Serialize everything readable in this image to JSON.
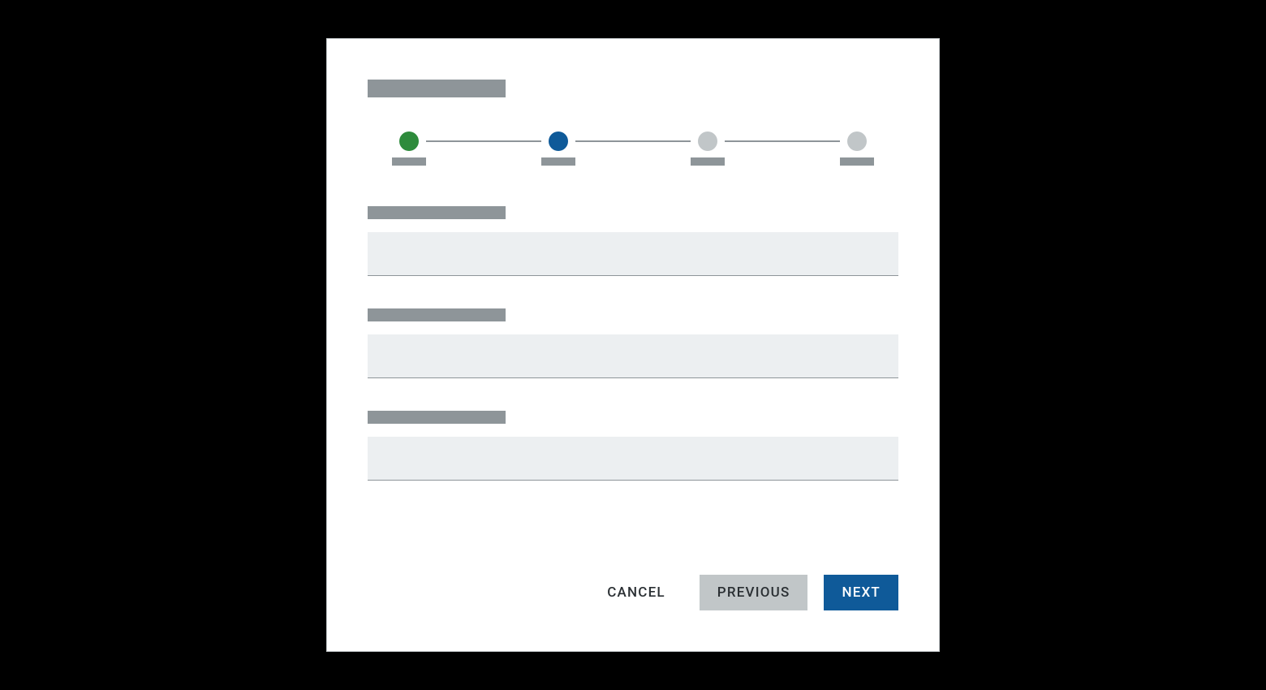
{
  "dialog": {
    "title_placeholder": "",
    "stepper": {
      "steps": [
        {
          "state": "completed",
          "label": ""
        },
        {
          "state": "active",
          "label": ""
        },
        {
          "state": "pending",
          "label": ""
        },
        {
          "state": "pending",
          "label": ""
        }
      ]
    },
    "fields": [
      {
        "label": "",
        "value": ""
      },
      {
        "label": "",
        "value": ""
      },
      {
        "label": "",
        "value": ""
      }
    ],
    "buttons": {
      "cancel": "CANCEL",
      "previous": "PREVIOUS",
      "next": "NEXT"
    }
  },
  "colors": {
    "completed": "#2e8b3c",
    "active": "#0f5a99",
    "pending": "#c1c6c8",
    "placeholder": "#8e9599",
    "input_bg": "#eceff1",
    "primary": "#0f5a99"
  }
}
